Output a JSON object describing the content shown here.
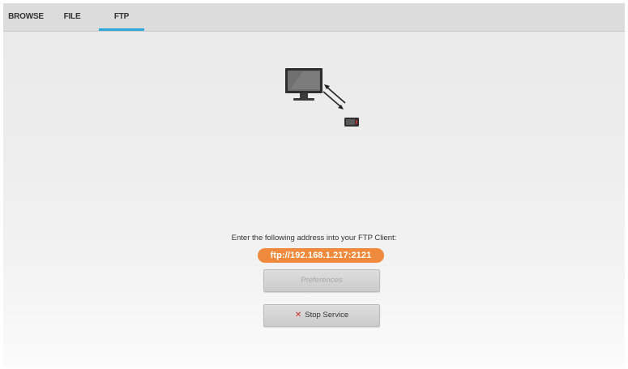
{
  "tabs": [
    {
      "label": "BROWSE",
      "active": false
    },
    {
      "label": "FILE",
      "active": false
    },
    {
      "label": "FTP",
      "active": true
    }
  ],
  "illustration": {
    "icons": [
      "monitor-icon",
      "bidirectional-arrow-icon",
      "device-icon"
    ]
  },
  "ftp": {
    "instruction": "Enter the following address into your FTP Client:",
    "address": "ftp://192.168.1.217:2121",
    "preferences_label": "Preferences",
    "stop_label": "Stop Service",
    "stop_icon": "close-icon"
  },
  "colors": {
    "accent_tab": "#2aa9d8",
    "address_pill": "#ef8a3c",
    "stop_icon": "#d02d2d"
  }
}
